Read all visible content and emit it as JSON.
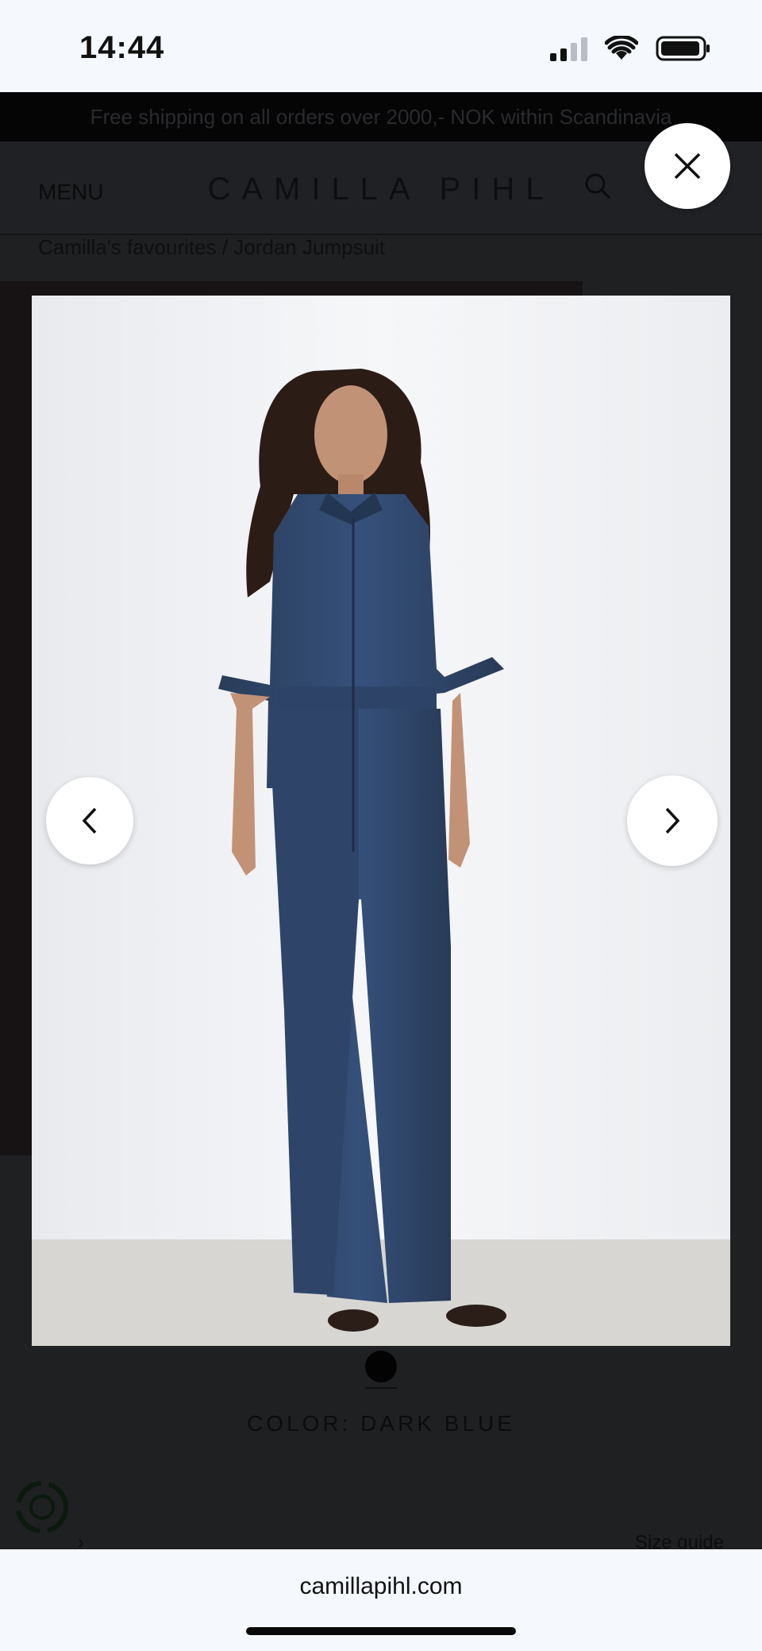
{
  "status_bar": {
    "time": "14:44",
    "signal_icon": "cellular-signal-icon",
    "wifi_icon": "wifi-icon",
    "battery_icon": "battery-icon"
  },
  "banner": {
    "text": "Free shipping on all orders over 2000,- NOK within Scandinavia"
  },
  "header": {
    "menu_label": "MENU",
    "logo": "CAMILLA PIHL",
    "search_icon": "search-icon"
  },
  "breadcrumb": "Camilla's favourites / Jordan Jumpsuit",
  "product": {
    "color_label": "COLOR: DARK BLUE",
    "size_guide": "Size guide",
    "image_alt": "Model wearing dark blue denim jumpsuit"
  },
  "lightbox": {
    "close_icon": "close-icon",
    "prev_icon": "chevron-left-icon",
    "next_icon": "chevron-right-icon"
  },
  "browser": {
    "url": "camillapihl.com"
  },
  "colors": {
    "denim": "#2f4666",
    "backdrop": "#1f2022",
    "photo_bg": "#eff0f2"
  }
}
